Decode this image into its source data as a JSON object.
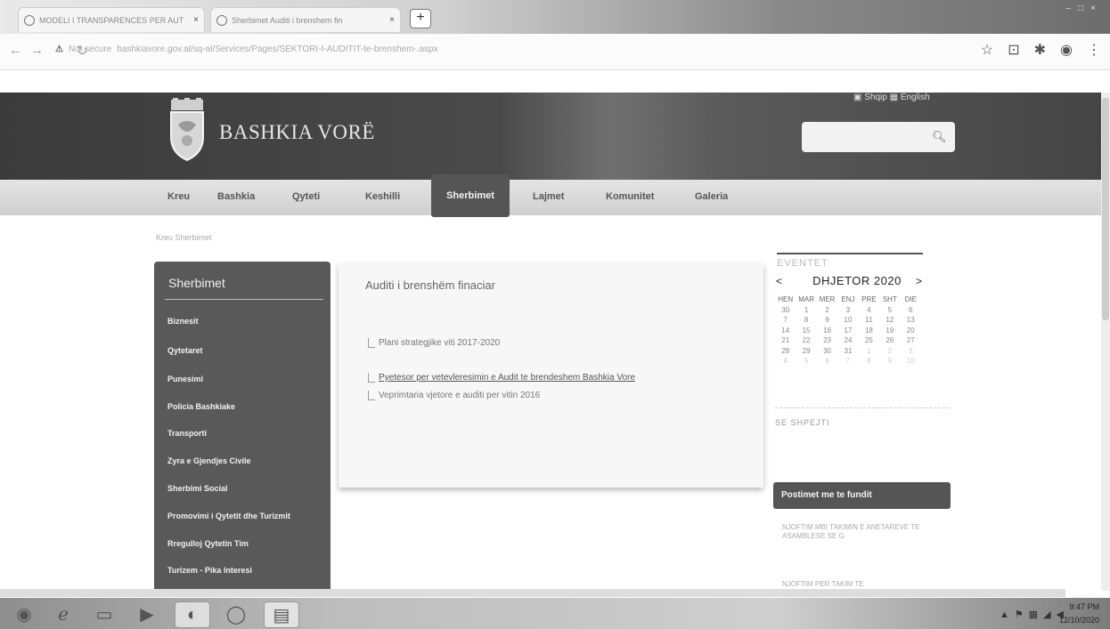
{
  "browser": {
    "tabs": [
      {
        "label": "MODELI I TRANSPARENCES PER AUT"
      },
      {
        "label": "Sherbimet Auditi i brenshem fin"
      }
    ],
    "url_prefix": "Not secure",
    "url": "bashkiavore.gov.al/sq-al/Services/Pages/SEKTORI-I-AUDITIT-te-brenshem-.aspx"
  },
  "header": {
    "brand": "BASHKIA VORË",
    "lang_shqip": "Shqip",
    "lang_english": "English"
  },
  "nav": {
    "items": [
      "Kreu",
      "Bashkia",
      "Qyteti",
      "Keshilli",
      "Sherbimet",
      "Lajmet",
      "Komunitet",
      "Galeria"
    ]
  },
  "breadcrumb": "Kreu  Sherbimet",
  "sidebar": {
    "title": "Sherbimet",
    "items": [
      "Biznesit",
      "Qytetaret",
      "Punesimi",
      "Policia Bashkiake",
      "Transporti",
      "Zyra e Gjendjes Civile",
      "Sherbimi Social",
      "Promovimi i Qytetit dhe Turizmit",
      "Rregulloj Qytetin Tim",
      "Turizem - Pika Interesi"
    ]
  },
  "content": {
    "title": "Auditi i brenshëm finaciar",
    "documents": [
      "Plani strategjike viti 2017-2020",
      "Pyetesor per vetevleresimin e Audit te brendeshem Bashkia Vore",
      "Veprimtaria vjetore e auditi per vitin 2016"
    ]
  },
  "calendar": {
    "section": "EVENTET",
    "prev": "<",
    "next": ">",
    "month": "DHJETOR 2020",
    "weekdays": [
      "HEN",
      "MAR",
      "MER",
      "ENJ",
      "PRE",
      "SHT",
      "DIE"
    ],
    "weeks": [
      [
        "30",
        "1",
        "2",
        "3",
        "4",
        "5",
        "6"
      ],
      [
        "7",
        "8",
        "9",
        "10",
        "11",
        "12",
        "13"
      ],
      [
        "14",
        "15",
        "16",
        "17",
        "18",
        "19",
        "20"
      ],
      [
        "21",
        "22",
        "23",
        "24",
        "25",
        "26",
        "27"
      ],
      [
        "28",
        "29",
        "30",
        "31",
        "1",
        "2",
        "3"
      ],
      [
        "4",
        "5",
        "6",
        "7",
        "8",
        "9",
        "10"
      ]
    ],
    "footer": "SE SHPEJTI"
  },
  "posts": {
    "header": "Postimet me te fundit",
    "items": [
      "NJOFTIM MBI TAKIMIN E ANETAREVE TE ASAMBLESE SE G",
      "NJOFTIM PER TAKIM TE"
    ]
  },
  "taskbar": {
    "time": "9:47 PM",
    "date": "12/10/2020"
  }
}
